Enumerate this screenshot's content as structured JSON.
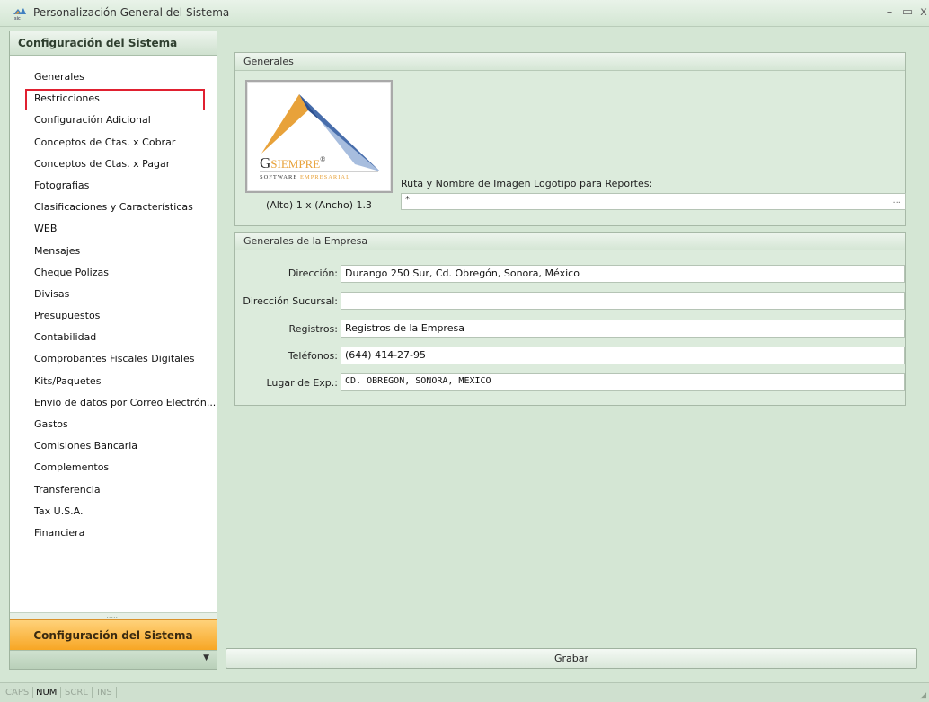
{
  "window": {
    "title": "Personalización General del Sistema",
    "icon_label": "sic",
    "minimize": "–",
    "maximize": "▭",
    "close": "x"
  },
  "sidebar": {
    "header": "Configuración del Sistema",
    "items": [
      "Generales",
      "Restricciones",
      "Configuración Adicional",
      "Conceptos de Ctas. x Cobrar",
      "Conceptos de Ctas. x Pagar",
      "Fotografias",
      "Clasificaciones y Características",
      "WEB",
      "Mensajes",
      "Cheque Polizas",
      "Divisas",
      "Presupuestos",
      "Contabilidad",
      "Comprobantes Fiscales Digitales",
      "Kits/Paquetes",
      "Envio de datos por Correo Electrón...",
      "Gastos",
      "Comisiones Bancaria",
      "Complementos",
      "Transferencia",
      "Tax U.S.A.",
      "Financiera"
    ],
    "highlighted_index": 1,
    "splitter_dots": "......",
    "bottom_tab": "Configuración del Sistema",
    "bottom_chevron": "▼"
  },
  "generales": {
    "header": "Generales",
    "logo_brand_g": "G",
    "logo_brand_rest": "SIEMPRE",
    "logo_reg": "®",
    "logo_tagline_a": "SOFTWARE",
    "logo_tagline_b": "EMPRESARIAL",
    "logo_caption": "(Alto) 1 x (Ancho) 1.3",
    "logo_path_label": "Ruta y Nombre de Imagen Logotipo para Reportes:",
    "logo_path_value": "*",
    "ellipsis": "..."
  },
  "empresa": {
    "header": "Generales de la Empresa",
    "fields": [
      {
        "label": "Dirección:",
        "value": "Durango 250 Sur, Cd. Obregón, Sonora, México"
      },
      {
        "label": "Dirección Sucursal:",
        "value": ""
      },
      {
        "label": "Registros:",
        "value": "Registros de la Empresa"
      },
      {
        "label": "Teléfonos:",
        "value": "(644) 414-27-95"
      },
      {
        "label": "Lugar de Exp.:",
        "value": "CD. OBREGON, SONORA, MEXICO"
      }
    ]
  },
  "actions": {
    "save_label": "Grabar"
  },
  "statusbar": {
    "caps": "CAPS",
    "num": "NUM",
    "scrl": "SCRL",
    "ins": "INS"
  },
  "colors": {
    "accent_orange": "#f7a624",
    "highlight_red": "#e02030",
    "panel_green": "#d4e6d4"
  }
}
